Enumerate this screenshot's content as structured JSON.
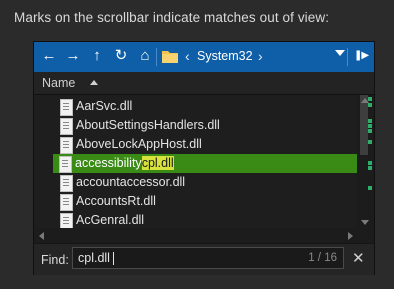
{
  "caption": "Marks on the scrollbar indicate matches out of view:",
  "toolbar": {
    "back_icon": "←",
    "forward_icon": "→",
    "up_icon": "↑",
    "refresh_icon": "↻",
    "home_icon": "⌂",
    "crumb_left": "‹",
    "crumb_right": "›",
    "location": "System32",
    "pane_icon": "❚▶"
  },
  "list": {
    "column_name": "Name",
    "files": [
      {
        "name": "AarSvc.dll"
      },
      {
        "name": "AboutSettingsHandlers.dll"
      },
      {
        "name": "AboveLockAppHost.dll"
      },
      {
        "name_prefix": "accessibility",
        "name_match": "cpl.dll",
        "selected": true
      },
      {
        "name": "accountaccessor.dll"
      },
      {
        "name": "AccountsRt.dll"
      },
      {
        "name": "AcGenral.dll"
      }
    ]
  },
  "find": {
    "label": "Find:",
    "value": "cpl.dll",
    "count": "1 / 16",
    "close_icon": "✕"
  },
  "colors": {
    "toolbar": "#0f5fa8",
    "selection": "#3a8a16",
    "match_highlight": "#d7e33a",
    "scroll_mark": "#2fae6a"
  }
}
